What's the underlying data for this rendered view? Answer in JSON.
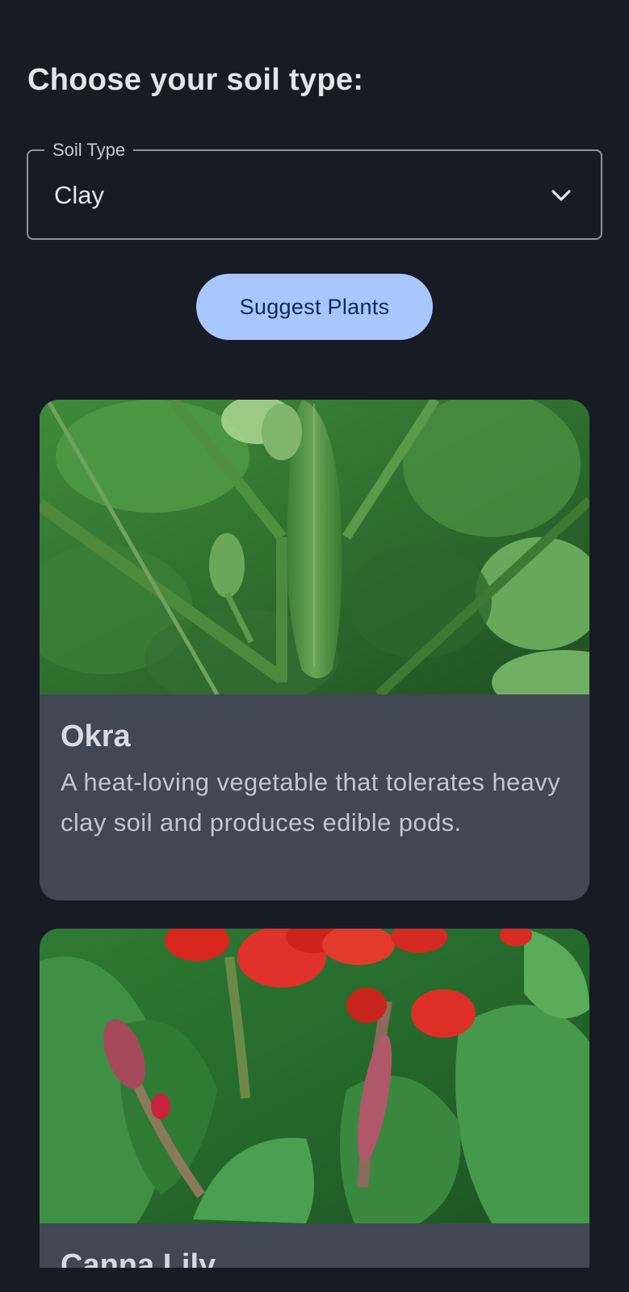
{
  "header": {
    "title": "Choose your soil type:"
  },
  "soil_dropdown": {
    "label": "Soil Type",
    "selected_value": "Clay",
    "icon": "chevron-down-icon"
  },
  "actions": {
    "suggest_label": "Suggest Plants"
  },
  "plants": [
    {
      "name": "Okra",
      "description": "A heat-loving vegetable that tolerates heavy clay soil and produces edible pods.",
      "image": "okra-plant-photo"
    },
    {
      "name": "Canna Lily",
      "image": "canna-lily-photo"
    }
  ],
  "colors": {
    "background": "#171b24",
    "button": "#a9c7ff",
    "button_text": "#0c2a55",
    "card": "#424754"
  }
}
